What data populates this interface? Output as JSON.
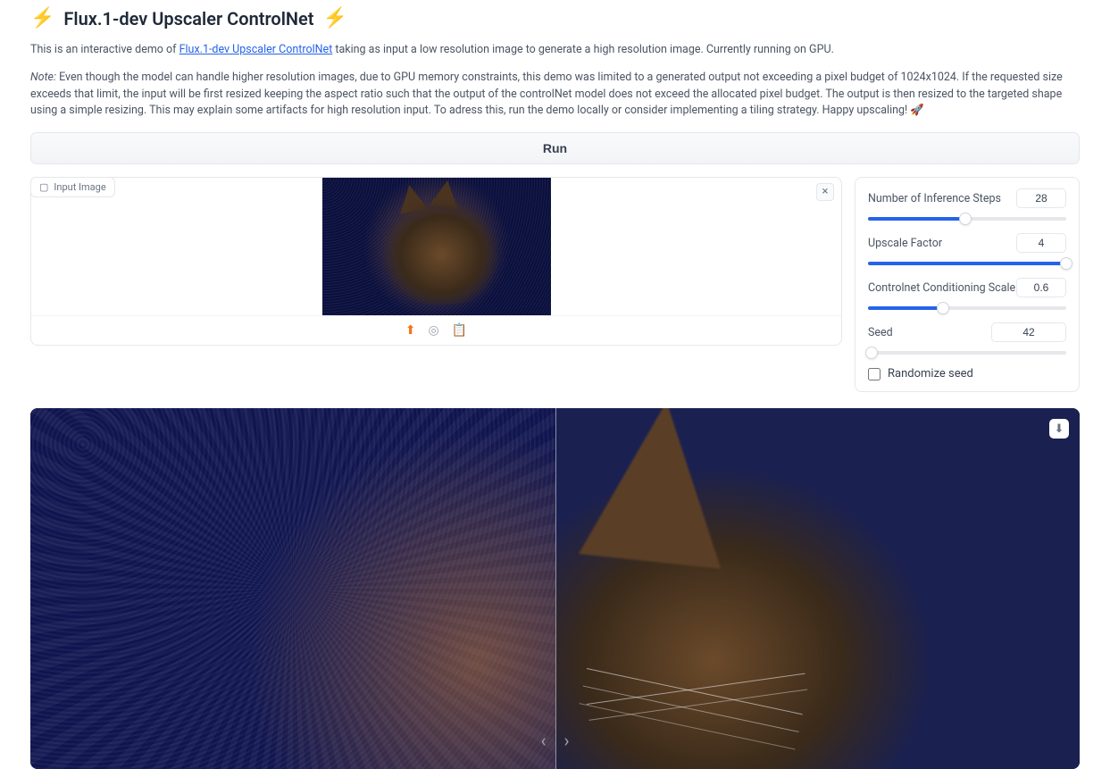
{
  "title": "Flux.1-dev Upscaler ControlNet",
  "desc_prefix": "This is an interactive demo of ",
  "desc_link": "Flux.1-dev Upscaler ControlNet",
  "desc_suffix": " taking as input a low resolution image to generate a high resolution image. Currently running on GPU.",
  "note_label": "Note:",
  "note_body": " Even though the model can handle higher resolution images, due to GPU memory constraints, this demo was limited to a generated output not exceeding a pixel budget of 1024x1024. If the requested size exceeds that limit, the input will be first resized keeping the aspect ratio such that the output of the controlNet model does not exceed the allocated pixel budget. The output is then resized to the targeted shape using a simple resizing. This may explain some artifacts for high resolution input. To adress this, run the demo locally or consider implementing a tiling strategy. Happy upscaling! 🚀",
  "run_label": "Run",
  "input_tag": "Input Image",
  "sliders": {
    "steps": {
      "label": "Number of Inference Steps",
      "value": "28",
      "pct": 49
    },
    "upscale": {
      "label": "Upscale Factor",
      "value": "4",
      "pct": 100
    },
    "cond": {
      "label": "Controlnet Conditioning Scale",
      "value": "0.6",
      "pct": 38
    },
    "seed": {
      "label": "Seed",
      "value": "42",
      "pct": 2
    }
  },
  "randomize_label": "Randomize seed"
}
